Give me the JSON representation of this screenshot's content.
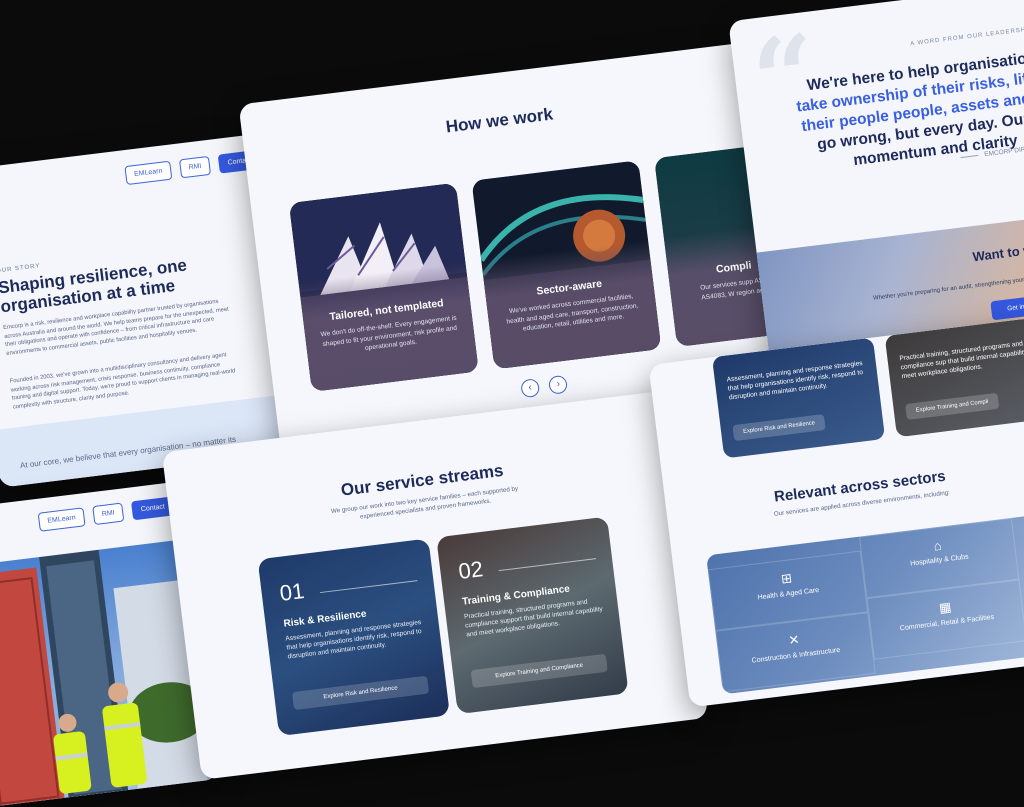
{
  "nav": {
    "emlearn": "EMLearn",
    "rmi": "RMI",
    "contact": "Contact"
  },
  "story": {
    "kicker": "OUR STORY",
    "title": "Shaping resilience, one organisation at a time",
    "para1": "Emcorp is a risk, resilience and workplace capability partner trusted by organisations across Australia and around the world. We help teams prepare for the unexpected, meet their obligations and operate with confidence – from critical infrastructure and care environments to commercial assets, public facilities and hospitality venues.",
    "para2": "Founded in 2003, we've grown into a multidisciplinary consultancy and delivery agent working across risk management, crisis response, business continuity, compliance training and digital support. Today, we're proud to support clients in managing real-world complexity with structure, clarity and purpose.",
    "band": "At our core, we believe that every organisation – no matter its"
  },
  "how": {
    "title": "How we work",
    "cards": [
      {
        "title": "Tailored, not templated",
        "desc": "We don't do off-the-shelf. Every engagement is shaped to fit your environment, risk profile and operational goals."
      },
      {
        "title": "Sector-aware",
        "desc": "We've worked across commercial facilities, health and aged care, transport, construction, education, retail, utilities and more."
      },
      {
        "title": "Compli",
        "desc": "Our services supp AS3745, AS4083, W region and co"
      }
    ],
    "prev_icon": "chevron-left-icon",
    "next_icon": "chevron-right-icon"
  },
  "quote": {
    "kicker": "A WORD FROM OUR LEADERSHIP",
    "line1": "We're here to help organisations",
    "line2_hl": "take ownership of their risks, lift the",
    "line3_hl": "their people people, assets and pro",
    "line4": "go wrong, but every day. Our ro",
    "line5": "momentum and clarity",
    "attribution": "EMCORP DIRECT",
    "cta_title": "Want to wo",
    "cta_sub": "Whether you're preparing for an audit, strengthening your team",
    "cta_button": "Get in touch"
  },
  "services": {
    "title": "Our service streams",
    "lead": "We group our work into two key service families – each supported by experienced specialists and proven frameworks.",
    "cards": [
      {
        "num": "01",
        "title": "Risk & Resilience",
        "desc": "Assessment, planning and response strategies that help organisations identify risk, respond to disruption and maintain continuity.",
        "button": "Explore Risk and Resilience"
      },
      {
        "num": "02",
        "title": "Training & Compliance",
        "desc": "Practical training, structured programs and compliance support that build internal capability and meet workplace obligations.",
        "button": "Explore Training and Compliance"
      }
    ]
  },
  "sectors": {
    "top_left_desc": "Assessment, planning and response strategies that help organisations identify risk, respond to disruption and maintain continuity.",
    "top_left_button": "Explore Risk and Resilience",
    "top_right_desc": "Practical training, structured programs and compliance sup that build internal capability meet workplace obligations.",
    "top_right_button": "Explore Training and Compli",
    "title": "Relevant across sectors",
    "lead": "Our services are applied across diverse environments, including:",
    "items": [
      {
        "label": "Health & Aged Care",
        "icon": "medical-kit-icon",
        "glyph": "⊞"
      },
      {
        "label": "Hospitality & Clubs",
        "icon": "hotel-icon",
        "glyph": "⌂"
      },
      {
        "label": "Construction & Infrastructure",
        "icon": "tools-icon",
        "glyph": "✕"
      },
      {
        "label": "Commercial, Retail & Facilities",
        "icon": "building-icon",
        "glyph": "▦"
      }
    ]
  },
  "colors": {
    "background": "#0b0b0c",
    "navy": "#1d2a5a",
    "accent": "#3459e0",
    "highlight": "#3a5fe0"
  }
}
